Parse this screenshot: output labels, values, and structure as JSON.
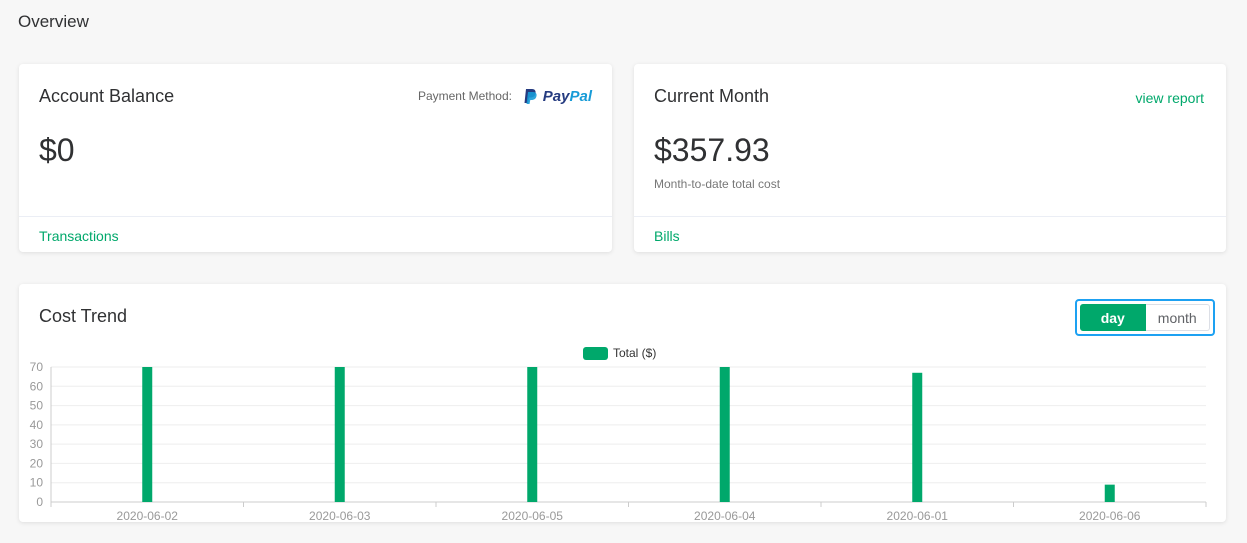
{
  "page": {
    "title": "Overview"
  },
  "account_balance": {
    "title": "Account Balance",
    "payment_method_label": "Payment Method:",
    "payment_logo_part1": "Pay",
    "payment_logo_part2": "Pal",
    "amount": "$0",
    "footer_link": "Transactions"
  },
  "current_month": {
    "title": "Current Month",
    "view_report": "view report",
    "amount": "$357.93",
    "caption": "Month-to-date total cost",
    "footer_link": "Bills"
  },
  "cost_trend": {
    "title": "Cost Trend",
    "toggle": {
      "day": "day",
      "month": "month",
      "selected": "day"
    }
  },
  "colors": {
    "accent": "#00a86b",
    "focus": "#1da1f2"
  },
  "chart_data": {
    "type": "bar",
    "categories": [
      "2020-06-02",
      "2020-06-03",
      "2020-06-05",
      "2020-06-04",
      "2020-06-01",
      "2020-06-06"
    ],
    "series": [
      {
        "name": "Total ($)",
        "values": [
          70,
          70,
          70,
          70,
          67,
          9
        ]
      }
    ],
    "yticks": [
      0,
      10,
      20,
      30,
      40,
      50,
      60,
      70
    ],
    "ylim": [
      0,
      70
    ],
    "grid": true,
    "legend": "top-center"
  }
}
